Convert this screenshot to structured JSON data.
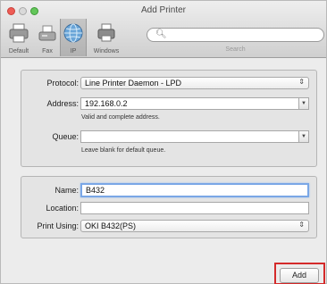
{
  "window": {
    "title": "Add Printer"
  },
  "toolbar": {
    "buttons": [
      {
        "label": "Default",
        "icon": "printer-icon"
      },
      {
        "label": "Fax",
        "icon": "fax-icon"
      },
      {
        "label": "IP",
        "icon": "globe-icon",
        "selected": true
      },
      {
        "label": "Windows",
        "icon": "printer-network-icon"
      }
    ],
    "search": {
      "placeholder": "",
      "caption": "Search"
    }
  },
  "connection": {
    "protocol_label": "Protocol:",
    "protocol_value": "Line Printer Daemon - LPD",
    "address_label": "Address:",
    "address_value": "192.168.0.2",
    "address_hint": "Valid and complete address.",
    "queue_label": "Queue:",
    "queue_value": "",
    "queue_hint": "Leave blank for default queue."
  },
  "details": {
    "name_label": "Name:",
    "name_value": "B432",
    "location_label": "Location:",
    "location_value": "",
    "print_using_label": "Print Using:",
    "print_using_value": "OKI B432(PS)"
  },
  "actions": {
    "add_label": "Add"
  },
  "colors": {
    "highlight": "#d42a2a",
    "focus_ring": "#7aa7e6"
  }
}
